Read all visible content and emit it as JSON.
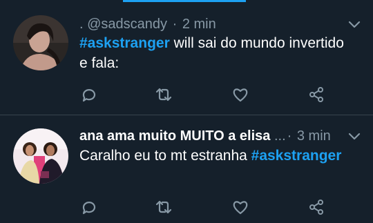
{
  "tweets": [
    {
      "prefix": ". ",
      "name": "",
      "handle": "@sadscandy",
      "separator": "·",
      "time": "2 min",
      "hashtag": "#askstranger",
      "text_after_hashtag": " will sai do mundo invertido e fala:",
      "text_before_hashtag": ""
    },
    {
      "prefix": "",
      "name": "ana ama muito MUITO a elisa",
      "handle": "...",
      "separator": "·",
      "time": "3 min",
      "hashtag": "#askstranger",
      "text_before_hashtag": "Caralho eu to mt estranha ",
      "text_after_hashtag": ""
    }
  ],
  "icons": [
    "reply-icon",
    "retweet-icon",
    "like-icon",
    "share-icon",
    "chevron-down-icon"
  ],
  "colors": {
    "background": "#15202b",
    "accent": "#1da1f2",
    "muted": "#8899a6",
    "divider": "#38444d"
  }
}
